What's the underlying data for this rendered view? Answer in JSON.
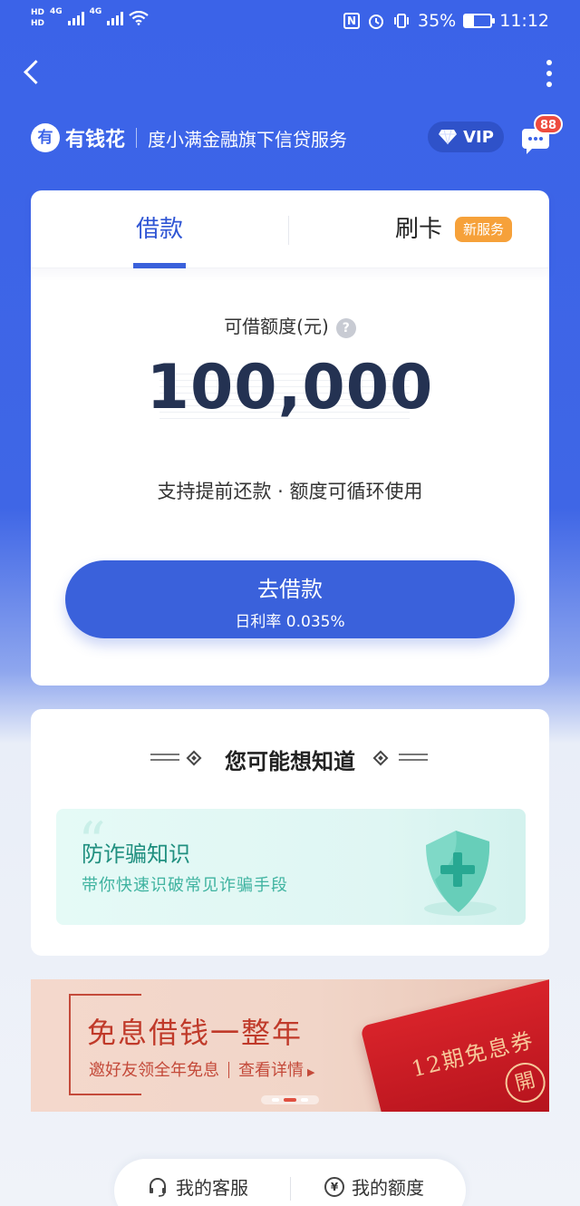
{
  "status_bar": {
    "left": [
      "HD",
      "HD",
      "4G",
      "4G"
    ],
    "battery_percent": "35%",
    "battery_level": 0.35,
    "time": "11:12"
  },
  "brand": {
    "logo_char": "有",
    "name": "有钱花",
    "slogan": "度小满金融旗下信贷服务",
    "vip_label": "VIP",
    "message_badge": "88"
  },
  "tabs": [
    {
      "label": "借款",
      "active": true
    },
    {
      "label": "刷卡",
      "tag": "新服务",
      "active": false
    }
  ],
  "credit": {
    "label": "可借额度(元)",
    "help": "?",
    "amount": "100,000",
    "features": "支持提前还款 · 额度可循环使用"
  },
  "loan_button": {
    "title": "去借款",
    "rate": "日利率 0.035%"
  },
  "knowledge": {
    "title": "您可能想知道",
    "item": {
      "title": "防诈骗知识",
      "subtitle": "带你快速识破常见诈骗手段"
    }
  },
  "banner": {
    "title": "免息借钱一整年",
    "sub_left": "邀好友领全年免息",
    "sub_right": "查看详情",
    "coupon_text": "12期免息券",
    "coupon_seal": "開",
    "active_dot": 1
  },
  "bottom_bar": {
    "service": "我的客服",
    "limit": "我的额度"
  },
  "colors": {
    "primary": "#3a61db",
    "tag_orange": "#f6a13a",
    "badge_red": "#ee4b3e",
    "fraud_green": "#1f8f7f",
    "banner_red": "#c03a2a"
  }
}
